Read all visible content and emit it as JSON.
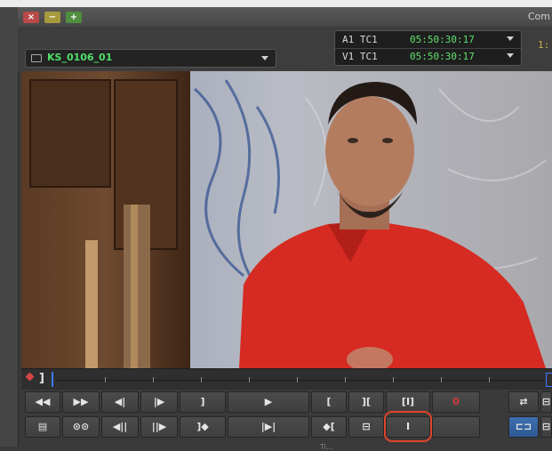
{
  "window": {
    "title": "Com",
    "close": "×",
    "minimize": "−",
    "maximize": "+"
  },
  "clip": {
    "name": "KS_0106_01"
  },
  "timecode": {
    "rows": [
      {
        "label": "A1 TC1",
        "value": "05:50:30:17"
      },
      {
        "label": "V1 TC1",
        "value": "05:50:30:17"
      }
    ],
    "right_partial": "1:"
  },
  "row1": [
    "◀◀",
    "▶▶",
    "◀|",
    "|▶",
    "]",
    "▶",
    "[",
    "][",
    "[I]",
    "0",
    "⇄",
    "⊟"
  ],
  "row2": [
    "▤",
    "⊙⊙",
    "◀||",
    "||▶",
    "]◆",
    "|▶|",
    "◆[",
    "⊟",
    "I",
    "",
    "⊏⊐",
    "⊟"
  ],
  "footer_partial": "Ti..."
}
